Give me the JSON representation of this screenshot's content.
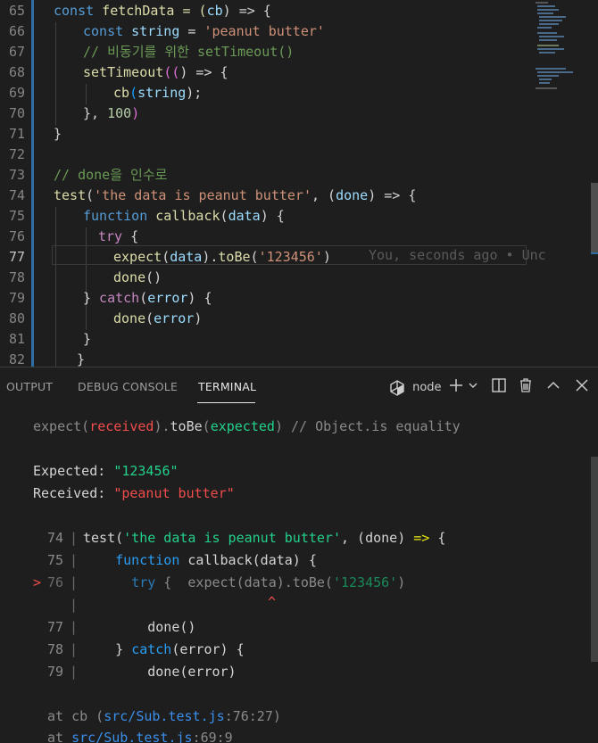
{
  "editor": {
    "lines": [
      {
        "num": "65",
        "active": false
      },
      {
        "num": "66",
        "active": false
      },
      {
        "num": "67",
        "active": false
      },
      {
        "num": "68",
        "active": false
      },
      {
        "num": "69",
        "active": false
      },
      {
        "num": "70",
        "active": false
      },
      {
        "num": "71",
        "active": false
      },
      {
        "num": "72",
        "active": false
      },
      {
        "num": "73",
        "active": false
      },
      {
        "num": "74",
        "active": false
      },
      {
        "num": "75",
        "active": false
      },
      {
        "num": "76",
        "active": false
      },
      {
        "num": "77",
        "active": true
      },
      {
        "num": "78",
        "active": false
      },
      {
        "num": "79",
        "active": false
      },
      {
        "num": "80",
        "active": false
      },
      {
        "num": "81",
        "active": false
      },
      {
        "num": "82",
        "active": false
      }
    ],
    "code": {
      "l65": [
        "const",
        " fetchData = (",
        "cb",
        ") => {"
      ],
      "l66": [
        "const",
        " string",
        " = ",
        "'peanut butter'"
      ],
      "l67": "// 비동기를 위한 setTimeout()",
      "l68": [
        "setTimeout",
        "((",
        ") => {"
      ],
      "l69": [
        "cb",
        "(",
        "string",
        ");"
      ],
      "l70": [
        "}, ",
        "100",
        ")"
      ],
      "l71": "}",
      "l73": "// done을 인수로",
      "l74": [
        "test",
        "(",
        "'the data is peanut butter'",
        ", (",
        "done",
        ") => {"
      ],
      "l75": [
        "function",
        " callback",
        "(",
        "data",
        ") {"
      ],
      "l76": [
        "try",
        " {"
      ],
      "l77": [
        "expect",
        "(",
        "data",
        ").",
        "toBe",
        "(",
        "'123456'",
        ")"
      ],
      "l78": [
        "done",
        "()"
      ],
      "l79": [
        "}",
        " catch",
        "(",
        "error",
        ") {"
      ],
      "l80": [
        "done",
        "(",
        "error",
        ")"
      ],
      "l81": "}",
      "l82": "}"
    },
    "blame": "You, seconds ago • Unc"
  },
  "panel": {
    "tabs": [
      {
        "label": "OUTPUT"
      },
      {
        "label": "DEBUG CONSOLE"
      },
      {
        "label": "TERMINAL"
      }
    ],
    "terminal_name": "node"
  },
  "terminal": {
    "l1": [
      "expect(",
      "received",
      ").",
      "toBe",
      "(",
      "expected",
      ") // Object.is equality"
    ],
    "expected_label": "Expected: ",
    "expected_value": "\"123456\"",
    "received_label": "Received: ",
    "received_value": "\"peanut butter\"",
    "snippet": [
      {
        "num": "74",
        "text": [
          "test(",
          "'the data is peanut butter'",
          ", (done) ",
          "=>",
          " {"
        ]
      },
      {
        "num": "75",
        "text": [
          "    ",
          "function",
          " callback(data) {"
        ]
      },
      {
        "num": "76",
        "text": [
          "      ",
          "try",
          " {  expect(data).toBe(",
          "'123456'",
          ")"
        ]
      },
      {
        "num": "77",
        "text": [
          "        done()"
        ]
      },
      {
        "num": "78",
        "text": [
          "    } ",
          "catch",
          "(error) {"
        ]
      },
      {
        "num": "79",
        "text": [
          "        done(error)"
        ]
      }
    ],
    "pointer": ">",
    "caret": "^",
    "stack1": [
      "at cb (",
      "src/Sub.test.js",
      ":76:27)"
    ],
    "stack2": [
      "at ",
      "src/Sub.test.js",
      ":69:9"
    ]
  }
}
